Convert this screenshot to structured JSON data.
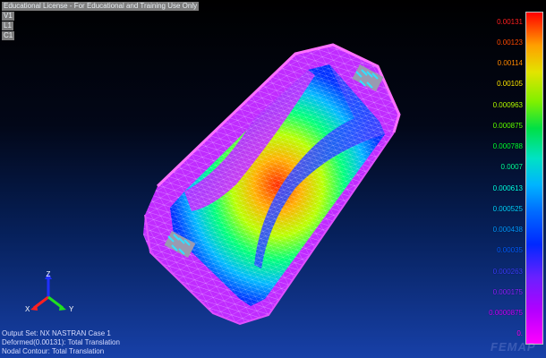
{
  "header": {
    "license": "Educational License - For Educational and Training Use Only",
    "view": "V1",
    "layer": "L1",
    "csys": "C1"
  },
  "legend": {
    "labels": [
      {
        "text": "0.00131",
        "color": "#ff2020"
      },
      {
        "text": "0.00123",
        "color": "#ff4a00"
      },
      {
        "text": "0.00114",
        "color": "#ff8a00"
      },
      {
        "text": "0.00105",
        "color": "#ffe600"
      },
      {
        "text": "0.000963",
        "color": "#b4ff00"
      },
      {
        "text": "0.000875",
        "color": "#5cff00"
      },
      {
        "text": "0.000788",
        "color": "#00ff30"
      },
      {
        "text": "0.0007",
        "color": "#00ff99"
      },
      {
        "text": "0.000613",
        "color": "#00ffe6"
      },
      {
        "text": "0.000525",
        "color": "#00cfff"
      },
      {
        "text": "0.000438",
        "color": "#0096ff"
      },
      {
        "text": "0.00035",
        "color": "#005bff"
      },
      {
        "text": "0.000263",
        "color": "#3a3cff"
      },
      {
        "text": "0.000175",
        "color": "#8a20ff"
      },
      {
        "text": "0.0000875",
        "color": "#c800ff"
      },
      {
        "text": "0.",
        "color": "#ff00ff"
      }
    ]
  },
  "triad": {
    "x": "X",
    "y": "Y",
    "z": "Z"
  },
  "footer": {
    "output_set": "Output Set: NX NASTRAN Case 1",
    "deformed": "Deformed(0.00131): Total Translation",
    "contour": "Nodal Contour: Total Translation"
  },
  "watermark": "FEMAP"
}
